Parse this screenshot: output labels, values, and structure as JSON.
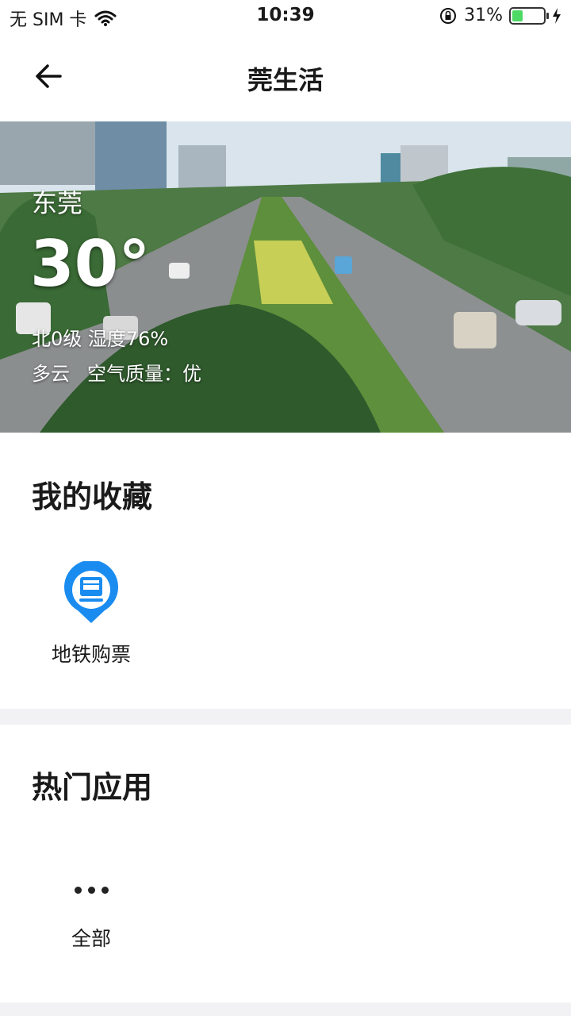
{
  "status": {
    "carrier": "无 SIM 卡",
    "time": "10:39",
    "battery": "31%",
    "battery_level": 0.31
  },
  "nav": {
    "title": "莞生活"
  },
  "weather": {
    "city": "东莞",
    "temperature": "30°",
    "wind_humidity": "北0级 湿度76%",
    "condition": "多云",
    "air_quality": "空气质量：优"
  },
  "favorites": {
    "title": "我的收藏",
    "items": [
      {
        "label": "地铁购票",
        "icon": "metro-ticket-icon"
      }
    ]
  },
  "hot_apps": {
    "title": "热门应用",
    "items": [
      {
        "label": "全部",
        "icon": "more-dots-icon"
      }
    ]
  },
  "colors": {
    "accent_blue": "#1a8cf0",
    "battery_green": "#4cd964"
  }
}
